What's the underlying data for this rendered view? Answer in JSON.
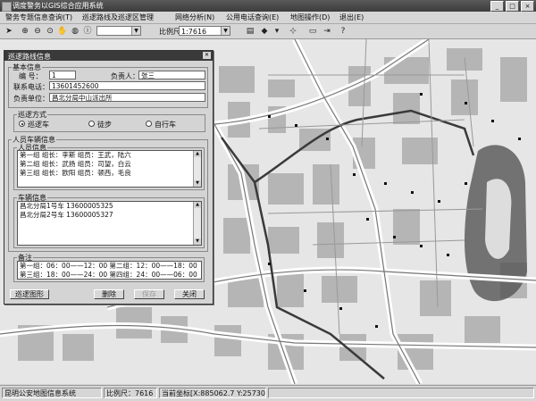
{
  "window": {
    "title": "调度警务以GIS综合应用系统",
    "controls": [
      "_",
      "□",
      "×"
    ]
  },
  "menu": [
    "警务专题信息查询(T)",
    "巡逻路线及巡逻区管理",
    "网络分析(N)",
    "公用电话查询(E)",
    "地图操作(D)",
    "退出(E)"
  ],
  "toolbar": {
    "icons": [
      "arrow-icon",
      "zoom-in-icon",
      "zoom-out-icon",
      "zoom-area-icon",
      "pan-icon",
      "globe-icon",
      "info-icon"
    ],
    "scale_label": "比例尺",
    "scale_value": "1:7616"
  },
  "dialog": {
    "title": "巡逻路线信息",
    "basic": {
      "section": "基本信息",
      "id_label": "编 号：",
      "id_value": "1",
      "leader_label": "负责人：",
      "leader_value": "张三",
      "phone_label": "联系电话：",
      "phone_value": "13601452600",
      "unit_label": "负责单位：",
      "unit_value": "昌北分局中山派出所"
    },
    "patrol_mode": {
      "section": "巡逻方式",
      "options": [
        {
          "label": "巡逻车",
          "selected": true
        },
        {
          "label": "徒步",
          "selected": false
        },
        {
          "label": "自行车",
          "selected": false
        }
      ]
    },
    "personnel_vehicle": {
      "section": "人员车辆信息",
      "persons_section": "人员信息",
      "persons": [
        "第一组  组长：李斯   组员：王武，陆六",
        "第二组  组长：武扬   组员：司望，白云",
        "第三组  组长：欧阳   组员：顿西，毛良"
      ],
      "vehicles_section": "车辆信息",
      "vehicles": [
        "昌北分局1号车  13600005325",
        "昌北分局2号车  13600005327"
      ]
    },
    "remarks": {
      "section": "备注",
      "lines": [
        "第一组：06：00——12：00  第二组：12：00——18：00",
        "第三组：18：00——24：00  第四组：24：00——06：00"
      ]
    },
    "buttons": {
      "route_map": "巡逻图形",
      "delete": "删除",
      "save": "保存",
      "close": "关闭"
    }
  },
  "status": {
    "system": "昆明公安地图信息系统",
    "scale_label": "比例尺：7616",
    "coords": "当前坐标[X:885062.7  Y:2573013.07]"
  }
}
